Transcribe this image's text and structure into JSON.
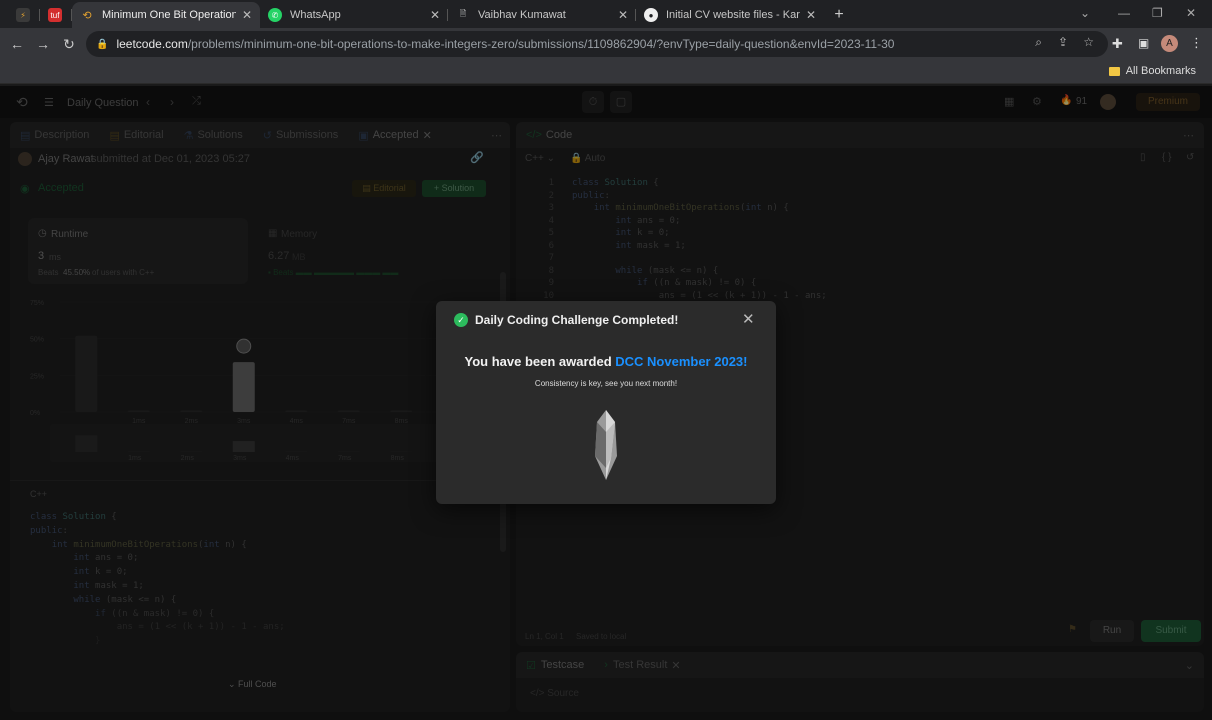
{
  "browser": {
    "tabs": [
      {
        "title": "",
        "favicon": "app-icon",
        "color": "#202124"
      },
      {
        "title": "",
        "favicon": "tuf-icon",
        "color": "#d32f2f"
      },
      {
        "title": "Minimum One Bit Operations to",
        "favicon": "leetcode-icon",
        "color": "#e0a030"
      },
      {
        "title": "WhatsApp",
        "favicon": "whatsapp-icon",
        "color": "#25d366"
      },
      {
        "title": "Vaibhav Kumawat",
        "favicon": "doc-icon",
        "color": "#eeeeee"
      },
      {
        "title": "Initial CV website files - Karansin",
        "favicon": "github-icon",
        "color": "#eeeeee"
      }
    ],
    "url_host": "leetcode.com",
    "url_path": "/problems/minimum-one-bit-operations-to-make-integers-zero/submissions/1109862904/?envType=daily-question&envId=2023-11-30",
    "profile_initial": "A",
    "bookmarks_label": "All Bookmarks"
  },
  "nav": {
    "daily_label": "Daily Question",
    "streak_count": "91",
    "premium_label": "Premium"
  },
  "left": {
    "tabs": [
      "Description",
      "Editorial",
      "Solutions",
      "Submissions",
      "Accepted"
    ],
    "submitter": "Ajay Rawat",
    "submitted_text": "submitted at Dec 01, 2023 05:27",
    "status": "Accepted",
    "editorial_btn": "Editorial",
    "solution_btn": "Solution",
    "runtime_label": "Runtime",
    "runtime_value": "3",
    "runtime_unit": "ms",
    "beats_prefix": "Beats",
    "beats_pct": "45.50%",
    "beats_suffix": "of users with C++",
    "memory_label": "Memory",
    "memory_value": "6.27",
    "memory_unit": "MB",
    "memory_beats": "Beats",
    "lang": "C++",
    "full_code": "Full Code"
  },
  "chart_data": {
    "type": "bar",
    "y_tick_labels": [
      "75%",
      "50%",
      "25%",
      "0%"
    ],
    "x_tick_labels": [
      "1ms",
      "2ms",
      "3ms",
      "4ms",
      "7ms",
      "8ms",
      "11ms"
    ],
    "mini_x_tick_labels": [
      "1ms",
      "2ms",
      "3ms",
      "4ms",
      "7ms",
      "8ms",
      "11ms"
    ],
    "ylim": [
      0,
      75
    ],
    "bars": [
      {
        "x": "0ms",
        "value": 52
      },
      {
        "x": "1ms",
        "value": 1
      },
      {
        "x": "2ms",
        "value": 1
      },
      {
        "x": "3ms",
        "value": 34,
        "highlight": true
      },
      {
        "x": "4ms",
        "value": 1
      },
      {
        "x": "7ms",
        "value": 1
      },
      {
        "x": "8ms",
        "value": 1
      },
      {
        "x": "11ms",
        "value": 1
      }
    ]
  },
  "code": {
    "lang_label": "Code",
    "language": "C++",
    "auto_label": "Auto",
    "lines": [
      "class Solution {",
      "public:",
      "    int minimumOneBitOperations(int n) {",
      "        int ans = 0;",
      "        int k = 0;",
      "        int mask = 1;",
      "",
      "        while (mask <= n) {",
      "            if ((n & mask) != 0) {",
      "                ans = (1 << (k + 1)) - 1 - ans;"
    ],
    "left_code_lines": [
      "class Solution {",
      "public:",
      "    int minimumOneBitOperations(int n) {",
      "        int ans = 0;",
      "        int k = 0;",
      "        int mask = 1;",
      "",
      "        while (mask <= n) {",
      "            if ((n & mask) != 0) {",
      "                ans = (1 << (k + 1)) - 1 - ans;",
      "            }"
    ],
    "status_left": "Ln 1, Col 1",
    "status_saved": "Saved to local",
    "run": "Run",
    "submit": "Submit",
    "testcase": "Testcase",
    "test_result": "Test Result",
    "source": "Source"
  },
  "modal": {
    "title": "Daily Coding Challenge Completed!",
    "award_prefix": "You have been awarded",
    "award_name": "DCC November 2023!",
    "subtitle": "Consistency is key, see you next month!"
  },
  "colors": {
    "accent_green": "#2cbb5d",
    "link_blue": "#1a90ff",
    "orange": "#ffa116"
  }
}
